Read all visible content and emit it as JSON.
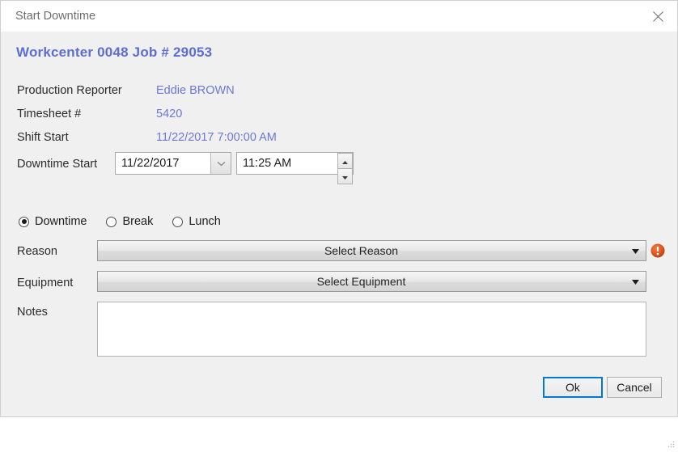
{
  "window": {
    "title": "Start Downtime",
    "close_icon": "close-icon",
    "resize_grip_icon": "resize-grip-icon"
  },
  "heading": "Workcenter  0048 Job # 29053",
  "info": [
    {
      "label": "Production Reporter",
      "value": "Eddie BROWN"
    },
    {
      "label": "Timesheet #",
      "value": "5420"
    },
    {
      "label": "Shift Start",
      "value": "11/22/2017 7:00:00 AM"
    }
  ],
  "downtime_start": {
    "label": "Downtime Start",
    "date_value": "11/22/2017",
    "date_dropdown_icon": "chevron-down-icon",
    "time_value": "11:25 AM",
    "spinner_up_icon": "spinner-up-icon",
    "spinner_down_icon": "spinner-down-icon"
  },
  "type_options": [
    {
      "label": "Downtime",
      "selected": true
    },
    {
      "label": "Break",
      "selected": false
    },
    {
      "label": "Lunch",
      "selected": false
    }
  ],
  "reason": {
    "label": "Reason",
    "value": "Select Reason",
    "arrow_icon": "dropdown-arrow-icon",
    "error_icon": "error-exclamation-icon"
  },
  "equipment": {
    "label": "Equipment",
    "value": "Select Equipment",
    "arrow_icon": "dropdown-arrow-icon"
  },
  "notes": {
    "label": "Notes",
    "value": "",
    "placeholder": ""
  },
  "buttons": {
    "ok": "Ok",
    "cancel": "Cancel"
  },
  "colors": {
    "heading": "#5b6ed6",
    "value_text": "#6b78d8",
    "focus_border": "#0078d7",
    "error": "#d9531e",
    "window_bg": "#f0f0f0",
    "titlebar_bg": "#ffffff"
  }
}
